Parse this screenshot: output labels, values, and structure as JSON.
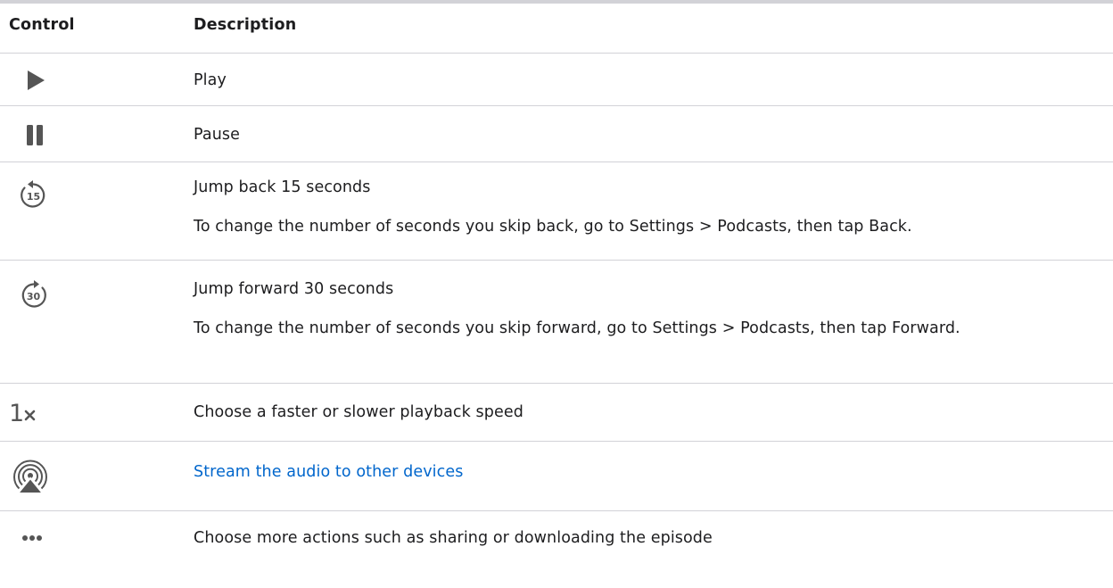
{
  "header": {
    "control": "Control",
    "description": "Description"
  },
  "rows": [
    {
      "icon": "play-icon",
      "label": "Play"
    },
    {
      "icon": "pause-icon",
      "label": "Pause"
    },
    {
      "icon": "skip-back-15-icon",
      "icon_text": "15",
      "label": "Jump back 15 seconds",
      "note": "To change the number of seconds you skip back, go to Settings > Podcasts, then tap Back."
    },
    {
      "icon": "skip-forward-30-icon",
      "icon_text": "30",
      "label": "Jump forward 30 seconds",
      "note": "To change the number of seconds you skip forward, go to Settings > Podcasts, then tap Forward."
    },
    {
      "icon": "playback-speed-icon",
      "icon_text": "1",
      "label": "Choose a faster or slower playback speed"
    },
    {
      "icon": "airplay-audio-icon",
      "label": "Stream the audio to other devices",
      "link_color": "#0066cc"
    },
    {
      "icon": "more-icon",
      "label": "Choose more actions such as sharing or downloading the episode"
    }
  ],
  "colors": {
    "icon": "#555555",
    "divider": "#d2d2d7",
    "text": "#1d1d1f",
    "link": "#0066cc"
  }
}
